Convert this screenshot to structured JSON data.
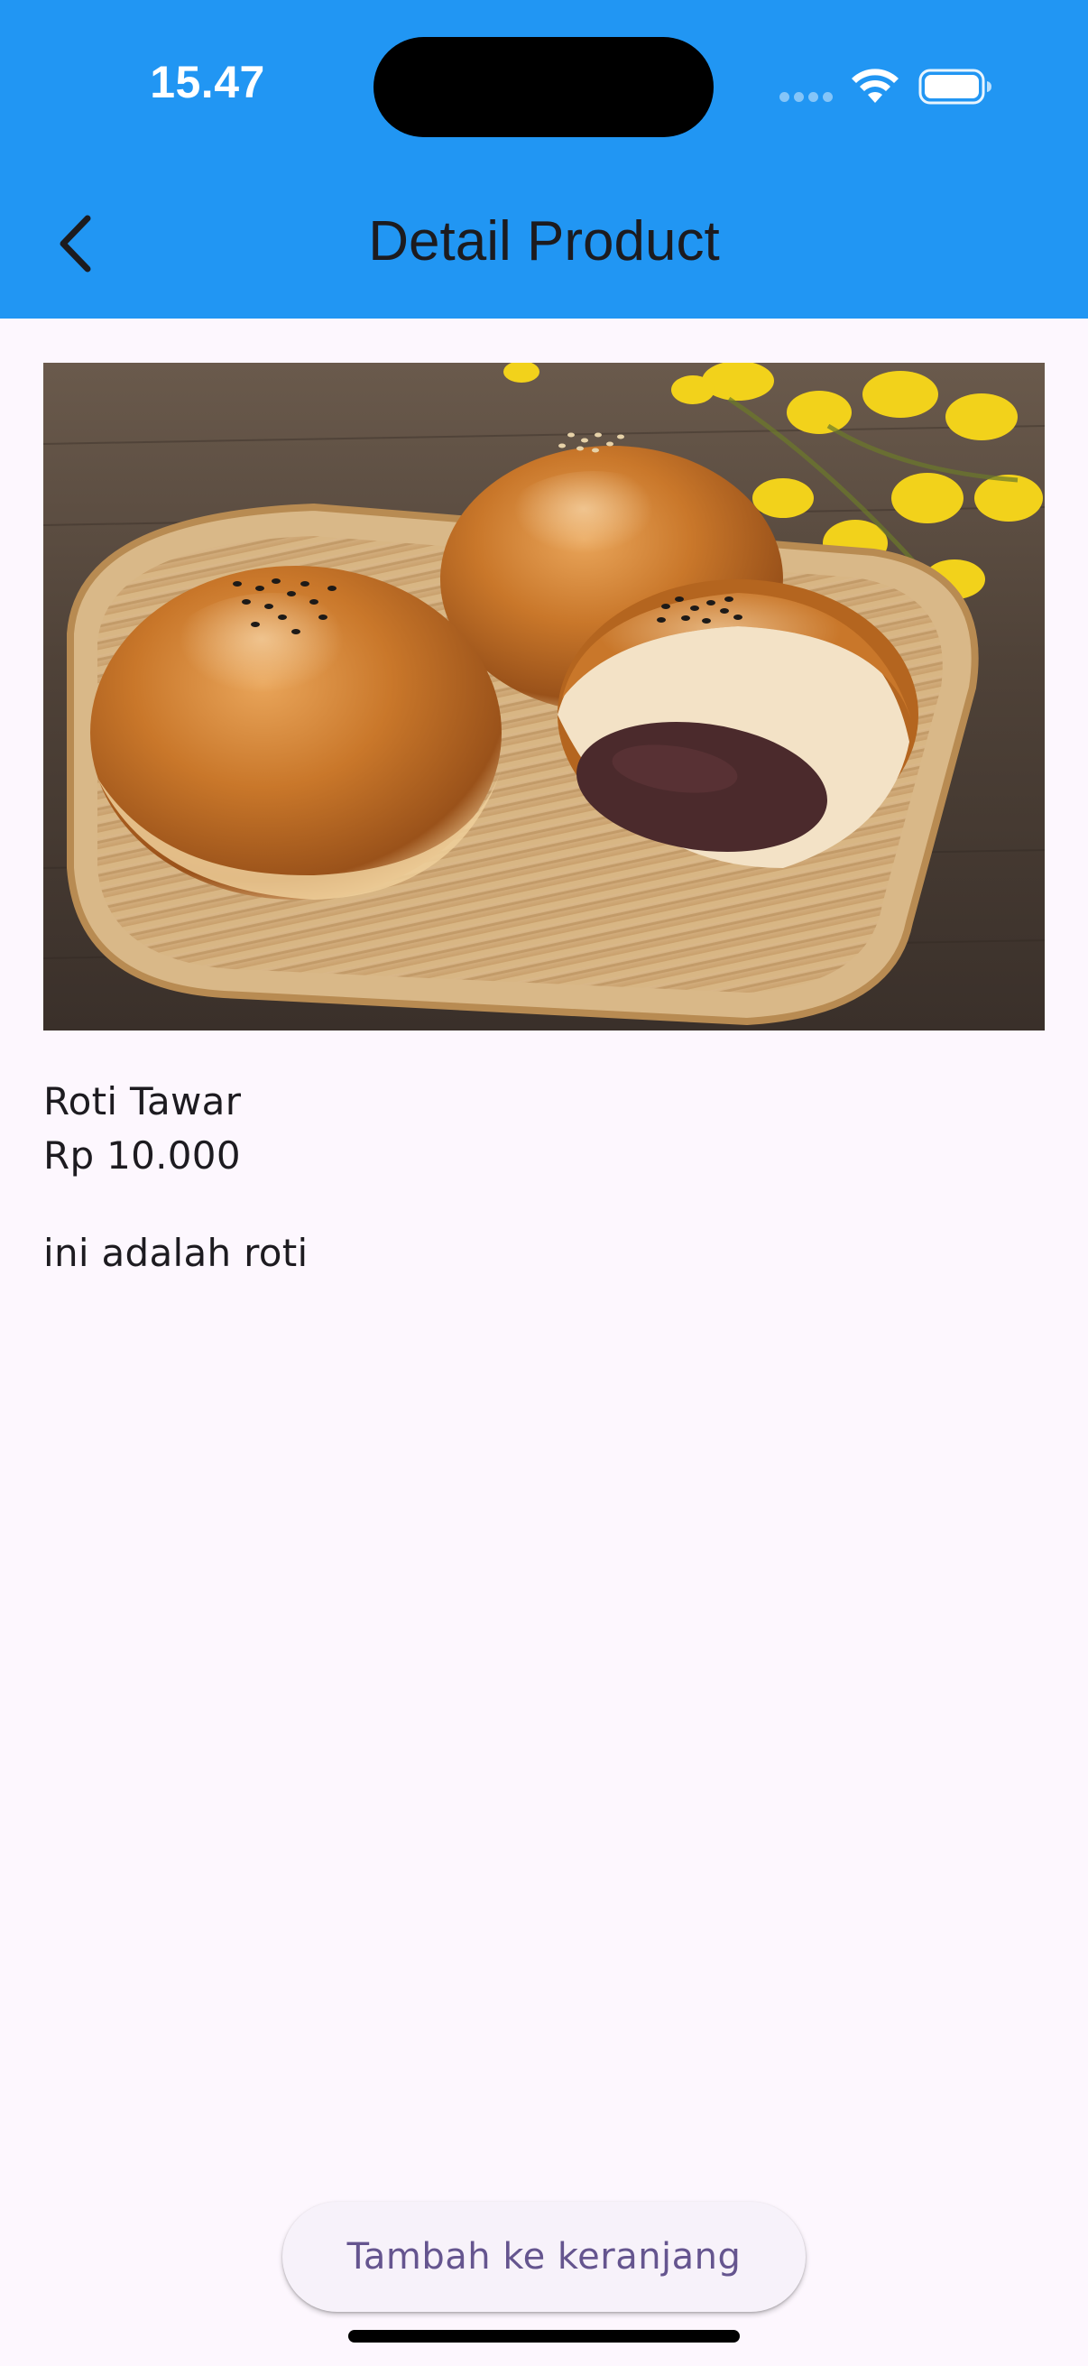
{
  "status_bar": {
    "time": "15.47",
    "icons": [
      "cellular-signal-icon",
      "wifi-icon",
      "battery-icon"
    ]
  },
  "app_bar": {
    "title": "Detail Product",
    "back_icon": "chevron-left-icon",
    "background_color": "#2196F3"
  },
  "product": {
    "name": "Roti Tawar",
    "price": "Rp 10.000",
    "description": "ini adalah roti"
  },
  "actions": {
    "add_to_cart_label": "Tambah ke keranjang"
  },
  "colors": {
    "page_background": "#FDF7FE",
    "button_background": "#F7F2FA",
    "button_text": "#65558F"
  }
}
